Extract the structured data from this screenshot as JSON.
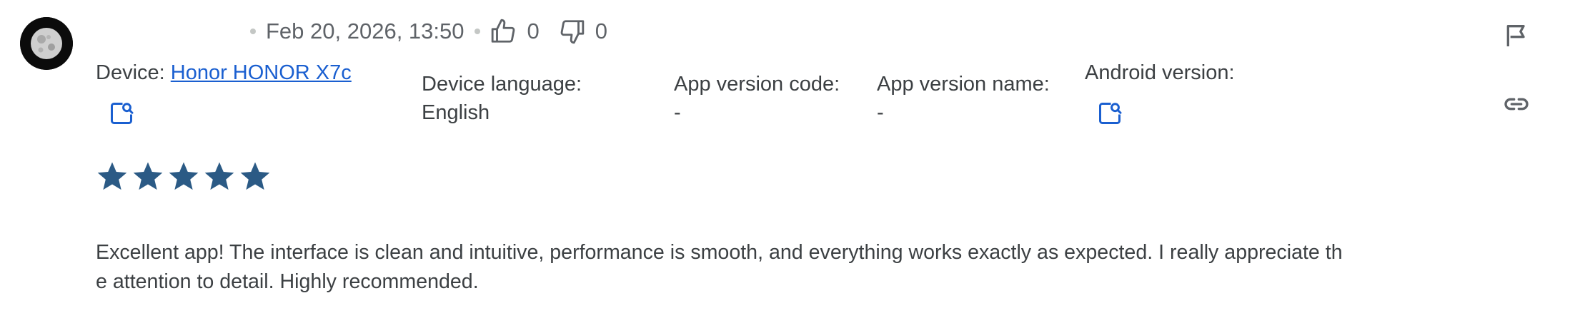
{
  "review": {
    "date": "Feb 20, 2026, 13:50",
    "likes": "0",
    "dislikes": "0",
    "rating": 5,
    "text": "Excellent app! The interface is clean and intuitive, performance is smooth, and everything works exactly as expected. I really appreciate th\ne attention to detail. Highly recommended."
  },
  "device": {
    "label": "Device:",
    "value": "Honor HONOR X7c"
  },
  "device_language": {
    "label": "Device language:",
    "value": "English"
  },
  "app_version_code": {
    "label": "App version code:",
    "value": "-"
  },
  "app_version_name": {
    "label": "App version name:",
    "value": "-"
  },
  "android_version": {
    "label": "Android version:"
  },
  "colors": {
    "star": "#2b5a85",
    "link": "#1a5fd0",
    "text": "#3c4043",
    "muted": "#5f6368"
  },
  "icons": [
    "avatar-moon",
    "thumb-up-icon",
    "thumb-down-icon",
    "lookup-icon",
    "flag-icon",
    "link-icon",
    "star-icon"
  ]
}
